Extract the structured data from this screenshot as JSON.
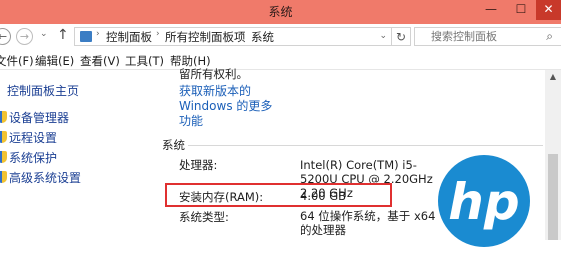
{
  "window": {
    "title": "系统",
    "minimize_glyph": "—",
    "maximize_glyph": "☐",
    "close_glyph": "✕"
  },
  "address": {
    "back_glyph": "←",
    "forward_glyph": "→",
    "dropdown_glyph": "⌄",
    "up_glyph": "↑",
    "path": [
      "控制面板",
      "所有控制面板项",
      "系统"
    ],
    "separator_glyph": "›",
    "refresh_glyph": "↻",
    "search_placeholder": "搜索控制面板",
    "search_icon": "search-icon"
  },
  "menu": {
    "items": [
      "文件(F)",
      "编辑(E)",
      "查看(V)",
      "工具(T)",
      "帮助(H)"
    ]
  },
  "sidebar": {
    "home_label": "控制面板主页",
    "links": [
      {
        "label": "设备管理器",
        "icon": "shield-icon"
      },
      {
        "label": "远程设置",
        "icon": "shield-icon"
      },
      {
        "label": "系统保护",
        "icon": "shield-icon"
      },
      {
        "label": "高级系统设置",
        "icon": "shield-icon"
      }
    ]
  },
  "main": {
    "copyright_fragment": "留所有权利。",
    "get_new_version": "获取新版本的 Windows 的更多功能",
    "section_title": "系统",
    "rows": [
      {
        "label": "处理器:",
        "value": "Intel(R) Core(TM) i5-5200U CPU @ 2.20GHz 2.20 GHz"
      },
      {
        "label": "安装内存(RAM):",
        "value": "4.00 GB"
      },
      {
        "label": "系统类型:",
        "value": "64 位操作系统，基于 x64 的处理器"
      }
    ]
  },
  "logo": {
    "text": "hp",
    "color": "#1a8bd1"
  },
  "colors": {
    "titlebar": "#f07a6a",
    "close_button": "#c8392a",
    "link": "#1b3f93",
    "highlight_border": "#e03030"
  }
}
